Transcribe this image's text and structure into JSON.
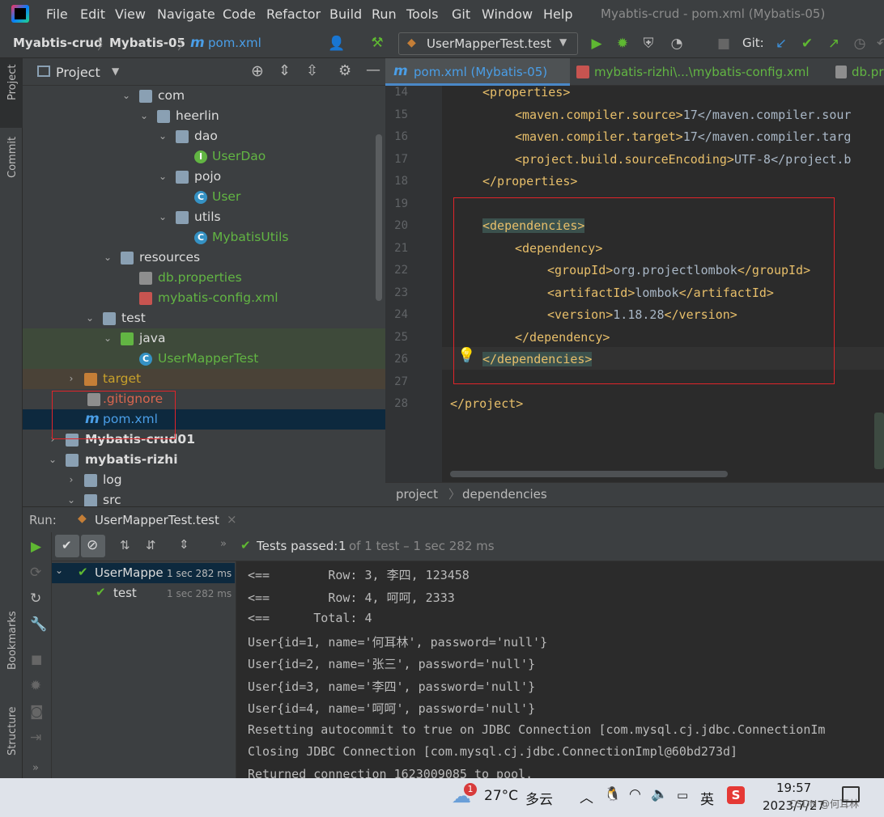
{
  "menubar": {
    "items": [
      "File",
      "Edit",
      "View",
      "Navigate",
      "Code",
      "Refactor",
      "Build",
      "Run",
      "Tools",
      "Git",
      "Window",
      "Help"
    ],
    "window_title": "Myabtis-crud - pom.xml (Mybatis-05)"
  },
  "navbar": {
    "crumbs": [
      "Myabtis-crud",
      "Mybatis-05",
      "pom.xml"
    ],
    "run_config": "UserMapperTest.test",
    "git_label": "Git:"
  },
  "stripe": {
    "project": "Project",
    "commit": "Commit",
    "bookmarks": "Bookmarks",
    "structure": "Structure"
  },
  "project": {
    "title": "Project",
    "tree": [
      {
        "label": "com",
        "kind": "folder",
        "arrow": "open"
      },
      {
        "label": "heerlin",
        "kind": "folder",
        "arrow": "open"
      },
      {
        "label": "dao",
        "kind": "folder",
        "arrow": "open"
      },
      {
        "label": "UserDao",
        "kind": "interface",
        "arrow": ""
      },
      {
        "label": "pojo",
        "kind": "folder",
        "arrow": "open"
      },
      {
        "label": "User",
        "kind": "class",
        "arrow": ""
      },
      {
        "label": "utils",
        "kind": "folder",
        "arrow": "open"
      },
      {
        "label": "MybatisUtils",
        "kind": "class",
        "arrow": ""
      },
      {
        "label": "resources",
        "kind": "folder",
        "arrow": "open"
      },
      {
        "label": "db.properties",
        "kind": "properties",
        "arrow": ""
      },
      {
        "label": "mybatis-config.xml",
        "kind": "xml",
        "arrow": ""
      },
      {
        "label": "test",
        "kind": "folder",
        "arrow": "open"
      },
      {
        "label": "java",
        "kind": "folder-green",
        "arrow": "open"
      },
      {
        "label": "UserMapperTest",
        "kind": "class",
        "arrow": ""
      },
      {
        "label": "target",
        "kind": "folder-orange",
        "arrow": "closed"
      },
      {
        "label": ".gitignore",
        "kind": "file",
        "arrow": ""
      },
      {
        "label": "pom.xml",
        "kind": "maven",
        "arrow": ""
      },
      {
        "label": "Mybatis-crud01",
        "kind": "module",
        "arrow": "closed"
      },
      {
        "label": "mybatis-rizhi",
        "kind": "module",
        "arrow": "open"
      },
      {
        "label": "log",
        "kind": "folder",
        "arrow": "closed"
      },
      {
        "label": "src",
        "kind": "folder",
        "arrow": "open"
      }
    ]
  },
  "editor": {
    "tabs": [
      "pom.xml (Mybatis-05)",
      "mybatis-rizhi\\...\\mybatis-config.xml",
      "db.pr"
    ],
    "lines": [
      {
        "n": "14",
        "indent": 1,
        "text": "<properties>"
      },
      {
        "n": "15",
        "indent": 2,
        "text": "<maven.compiler.source>17</maven.compiler.sour"
      },
      {
        "n": "16",
        "indent": 2,
        "text": "<maven.compiler.target>17</maven.compiler.targ"
      },
      {
        "n": "17",
        "indent": 2,
        "text": "<project.build.sourceEncoding>UTF-8</project.b"
      },
      {
        "n": "18",
        "indent": 1,
        "text": "</properties>"
      },
      {
        "n": "19",
        "indent": 0,
        "text": ""
      },
      {
        "n": "20",
        "indent": 1,
        "text": "<dependencies>"
      },
      {
        "n": "21",
        "indent": 2,
        "text": "<dependency>"
      },
      {
        "n": "22",
        "indent": 3,
        "text": "<groupId>org.projectlombok</groupId>"
      },
      {
        "n": "23",
        "indent": 3,
        "text": "<artifactId>lombok</artifactId>"
      },
      {
        "n": "24",
        "indent": 3,
        "text": "<version>1.18.28</version>"
      },
      {
        "n": "25",
        "indent": 2,
        "text": "</dependency>"
      },
      {
        "n": "26",
        "indent": 1,
        "text": "</dependencies>"
      },
      {
        "n": "27",
        "indent": 0,
        "text": ""
      },
      {
        "n": "28",
        "indent": 0,
        "text": "</project>"
      }
    ],
    "breadcrumbs": [
      "project",
      "dependencies"
    ]
  },
  "run": {
    "label": "Run:",
    "tab": "UserMapperTest.test",
    "status_prefix": "Tests passed:",
    "status_count": "1",
    "status_suffix": "of 1 test – 1 sec 282 ms",
    "tests": [
      {
        "name": "UserMappe",
        "time": "1 sec 282 ms"
      },
      {
        "name": "test",
        "time": "1 sec 282 ms"
      }
    ],
    "console": [
      "<==        Row: 3, 李四, 123458",
      "<==        Row: 4, 呵呵, 2333",
      "<==      Total: 4",
      "User{id=1, name='何耳林', password='null'}",
      "User{id=2, name='张三', password='null'}",
      "User{id=3, name='李四', password='null'}",
      "User{id=4, name='呵呵', password='null'}",
      "Resetting autocommit to true on JDBC Connection [com.mysql.cj.jdbc.ConnectionIm",
      "Closing JDBC Connection [com.mysql.cj.jdbc.ConnectionImpl@60bd273d]",
      "Returned connection 1623009085 to pool."
    ]
  },
  "taskbar": {
    "weather_badge": "1",
    "temperature": "27°C",
    "weather": "多云",
    "ime": "英",
    "time": "19:57",
    "date": "2023/7/27",
    "watermark": "CSDN @何耳林"
  },
  "colors": {
    "accent_red": "#e0242a",
    "pass_green": "#5fb832",
    "ide_bg": "#2b2b2b",
    "panel_bg": "#3c3f41"
  }
}
